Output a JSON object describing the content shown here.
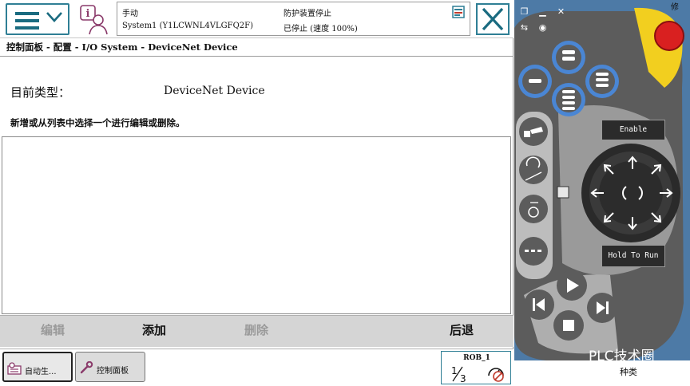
{
  "header": {
    "mode": "手动",
    "system": "System1 (Y1LCWNL4VLGFQ2F)",
    "guard": "防护装置停止",
    "state": "已停止 (速度 100%)"
  },
  "breadcrumb": "控制面板 - 配置 - I/O System - DeviceNet Device",
  "content": {
    "type_label": "目前类型：",
    "type_value": "DeviceNet Device",
    "instruction": "新增或从列表中选择一个进行编辑或删除。"
  },
  "commands": {
    "edit": "编辑",
    "add": "添加",
    "delete": "删除",
    "back": "后退"
  },
  "taskbar": {
    "auto": "自动生...",
    "control_panel": "控制面板",
    "rob": "ROB_1",
    "rob_fraction": "1/3"
  },
  "pendant": {
    "enable": "Enable",
    "hold_to_run": "Hold To Run",
    "watermark": "PLC技术圈",
    "corner_text": "修",
    "bottom_text": "种类"
  },
  "colors": {
    "accent": "#2f7f95",
    "pendant_blue": "#4d7aa6",
    "pendant_body": "#5f5f5f",
    "estop_red": "#d92020",
    "estop_yellow": "#f2cf1f",
    "button_ring": "#4a86d4"
  },
  "icons": [
    "menu-icon",
    "chevron-down-icon",
    "info-user-icon",
    "event-log-icon",
    "close-icon",
    "auto-production-icon",
    "wrench-icon",
    "speed-icon"
  ]
}
